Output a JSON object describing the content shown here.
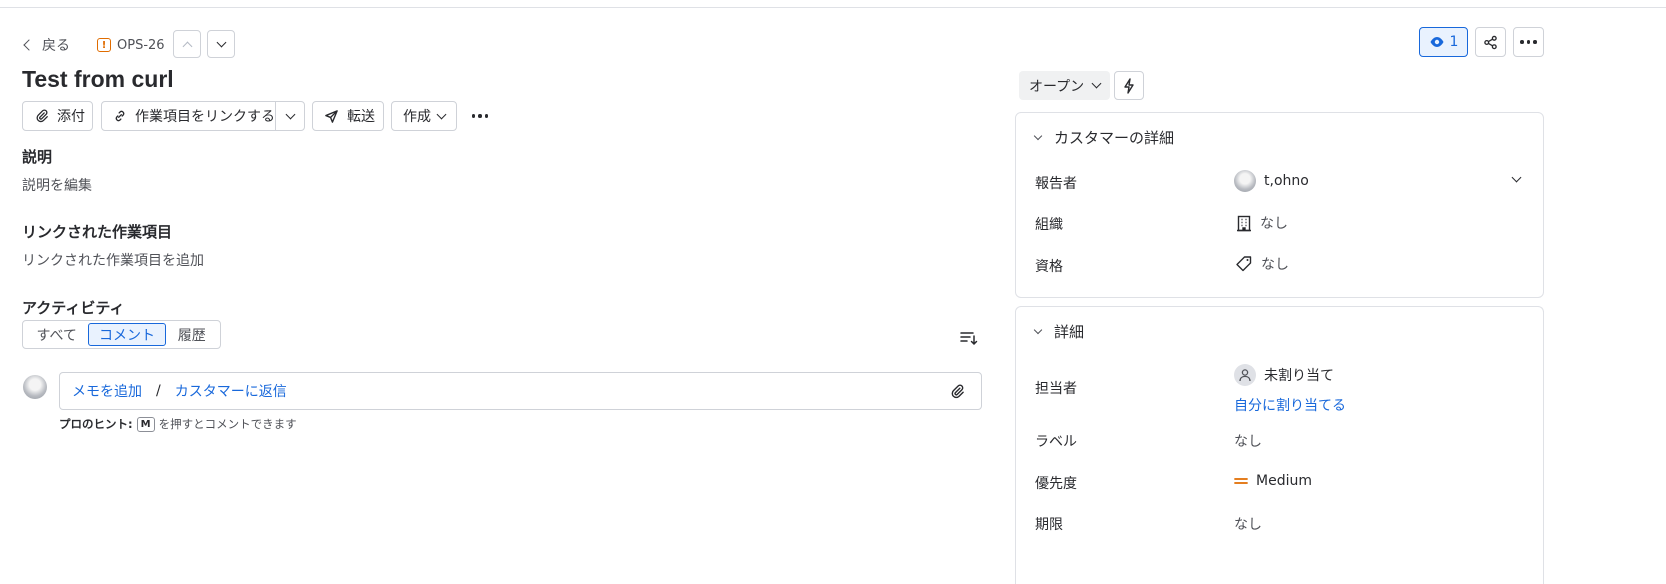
{
  "nav": {
    "back_label": "戻る",
    "issue_key": "OPS-26"
  },
  "issue": {
    "title": "Test from curl"
  },
  "toolbar": {
    "attach": "添付",
    "link_item": "作業項目をリンクする",
    "forward": "転送",
    "create": "作成"
  },
  "description": {
    "heading": "説明",
    "placeholder": "説明を編集"
  },
  "linked": {
    "heading": "リンクされた作業項目",
    "placeholder": "リンクされた作業項目を追加"
  },
  "activity": {
    "heading": "アクティビティ",
    "tabs": [
      "すべて",
      "コメント",
      "履歴"
    ],
    "active_tab": "コメント",
    "add_note": "メモを追加",
    "separator": "/",
    "reply_customer": "カスタマーに返信",
    "hint_prefix": "プロのヒント:",
    "hint_key": "M",
    "hint_suffix": "を押すとコメントできます"
  },
  "header_actions": {
    "watch_count": "1"
  },
  "status": {
    "label": "オープン"
  },
  "customer_panel": {
    "heading": "カスタマーの詳細",
    "fields": [
      {
        "label": "報告者",
        "value": "t,ohno"
      },
      {
        "label": "組織",
        "value": "なし"
      },
      {
        "label": "資格",
        "value": "なし"
      }
    ]
  },
  "details_panel": {
    "heading": "詳細",
    "assignee_label": "担当者",
    "assignee_value": "未割り当て",
    "assign_to_me": "自分に割り当てる",
    "label_label": "ラベル",
    "label_value": "なし",
    "priority_label": "優先度",
    "priority_value": "Medium",
    "due_label": "期限",
    "due_value": "なし"
  },
  "colors": {
    "accent": "#1868db",
    "priority_medium": "#e06c00",
    "issue_type": "#e06c00"
  }
}
